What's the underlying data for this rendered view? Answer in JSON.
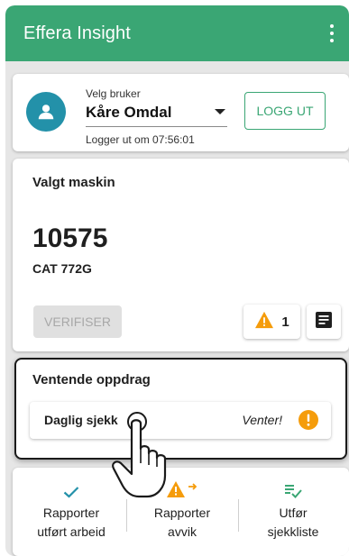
{
  "app": {
    "title": "Effera Insight",
    "menu_icon": "more-vert-icon",
    "brand_color": "#3aa674"
  },
  "user_panel": {
    "avatar_icon": "person-icon",
    "select_label": "Velg bruker",
    "selected_user": "Kåre Omdal",
    "logout_countdown": "Logger ut om 07:56:01",
    "logout_button": "LOGG UT"
  },
  "machine": {
    "heading": "Valgt maskin",
    "id": "10575",
    "model": "CAT 772G",
    "verify_button": "VERIFISER",
    "warning_count": "1",
    "warning_icon": "warning-icon",
    "notes_icon": "notes-icon"
  },
  "pending": {
    "heading": "Ventende oppdrag",
    "items": [
      {
        "title": "Daglig sjekk",
        "status": "Venter!",
        "status_icon": "alert-circle-icon",
        "status_color": "#f59c0b"
      }
    ]
  },
  "actions": [
    {
      "label_line1": "Rapporter",
      "label_line2": "utført arbeid",
      "icon": "check-icon",
      "color": "#2391a9"
    },
    {
      "label_line1": "Rapporter",
      "label_line2": "avvik",
      "icon": "warning-arrow-icon",
      "color": "#f59c0b"
    },
    {
      "label_line1": "Utfør",
      "label_line2": "sjekkliste",
      "icon": "checklist-icon",
      "color": "#3aa674"
    }
  ]
}
